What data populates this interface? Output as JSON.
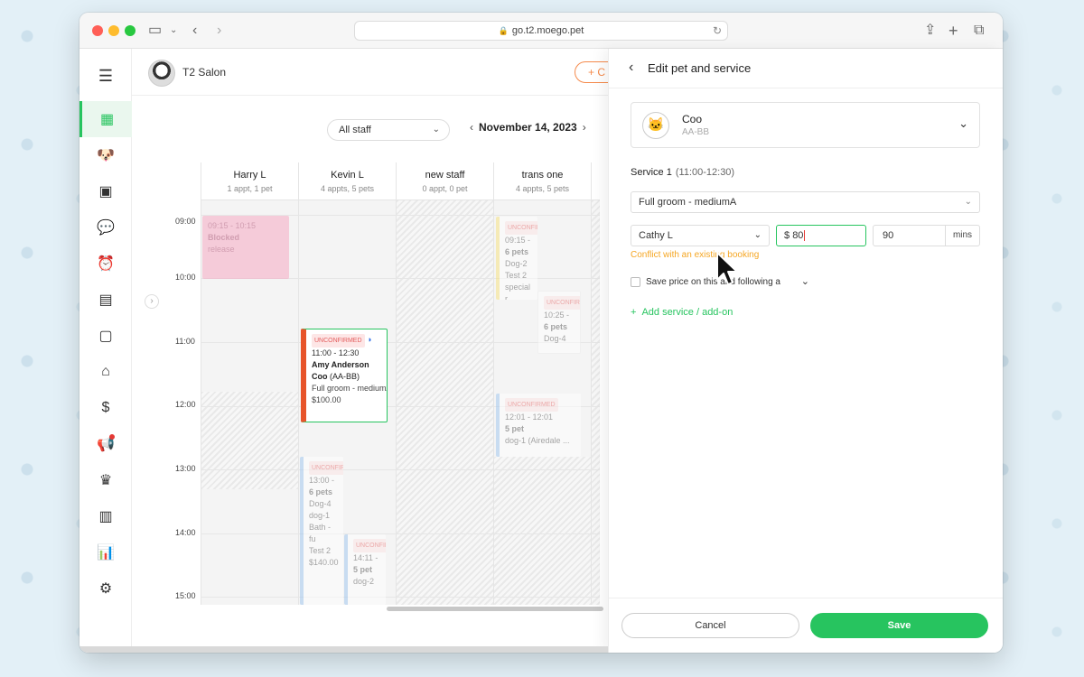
{
  "browser": {
    "url": "go.t2.moego.pet"
  },
  "topbar": {
    "salon_name": "T2 Salon",
    "create_label": "+ C"
  },
  "calendar": {
    "staff_filter": "All staff",
    "date": "November 14, 2023",
    "hours": [
      "09:00",
      "10:00",
      "11:00",
      "12:00",
      "13:00",
      "14:00",
      "15:00"
    ],
    "columns": [
      {
        "name": "Harry L",
        "sub": "1 appt, 1 pet"
      },
      {
        "name": "Kevin L",
        "sub": "4 appts, 5 pets"
      },
      {
        "name": "new staff",
        "sub": "0 appt, 0 pet"
      },
      {
        "name": "trans one",
        "sub": "4 appts, 5 pets"
      }
    ],
    "blocked": {
      "time": "09:15 - 10:15",
      "line1": "Blocked",
      "line2": "release"
    },
    "selected_appt": {
      "status": "UNCONFIRMED",
      "time": "11:00 - 12:30",
      "client": "Amy Anderson",
      "pet": "Coo",
      "pet_code": "(AA-BB)",
      "service": "Full groom - mediumA",
      "price": "$100.00"
    },
    "appt_trans_1": {
      "status": "UNCONFIRMED",
      "time": "09:15 -",
      "pets": "6 pets",
      "dog": "Dog-2",
      "test": "Test 2",
      "note": "special r"
    },
    "appt_trans_2": {
      "status": "UNCONFIRMED",
      "time": "10:25 -",
      "pets": "6 pets",
      "dog": "Dog-4"
    },
    "appt_trans_3": {
      "status": "UNCONFIRMED",
      "time": "12:01 - 12:01",
      "pets": "5 pet",
      "dog": "dog-1 (Airedale ..."
    },
    "appt_kevin_1": {
      "status": "UNCONFIRMED",
      "time": "13:00 -",
      "pets": "6 pets",
      "dog": "Dog-4",
      "dog2": "dog-1",
      "service": "Bath - fu",
      "test": "Test 2",
      "price": "$140.00"
    },
    "appt_kevin_2": {
      "status": "UNCONFIRMED",
      "time": "14:11 -",
      "pets": "5 pet",
      "dog": "dog-2"
    }
  },
  "panel": {
    "title": "Edit pet and service",
    "pet_name": "Coo",
    "pet_code": "AA-BB",
    "service_label": "Service 1",
    "service_time": "(11:00-12:30)",
    "service_name": "Full groom - mediumA",
    "staff": "Cathy L",
    "price_prefix": "$",
    "price_value": "80",
    "duration": "90",
    "duration_unit": "mins",
    "conflict": "Conflict with an existing booking",
    "save_price_label": "Save price on this and following a",
    "add_service": "Add service / add-on",
    "cancel": "Cancel",
    "save": "Save"
  },
  "colors": {
    "accent": "#27c45f",
    "warning": "#f5a623",
    "create": "#f58a4b"
  }
}
